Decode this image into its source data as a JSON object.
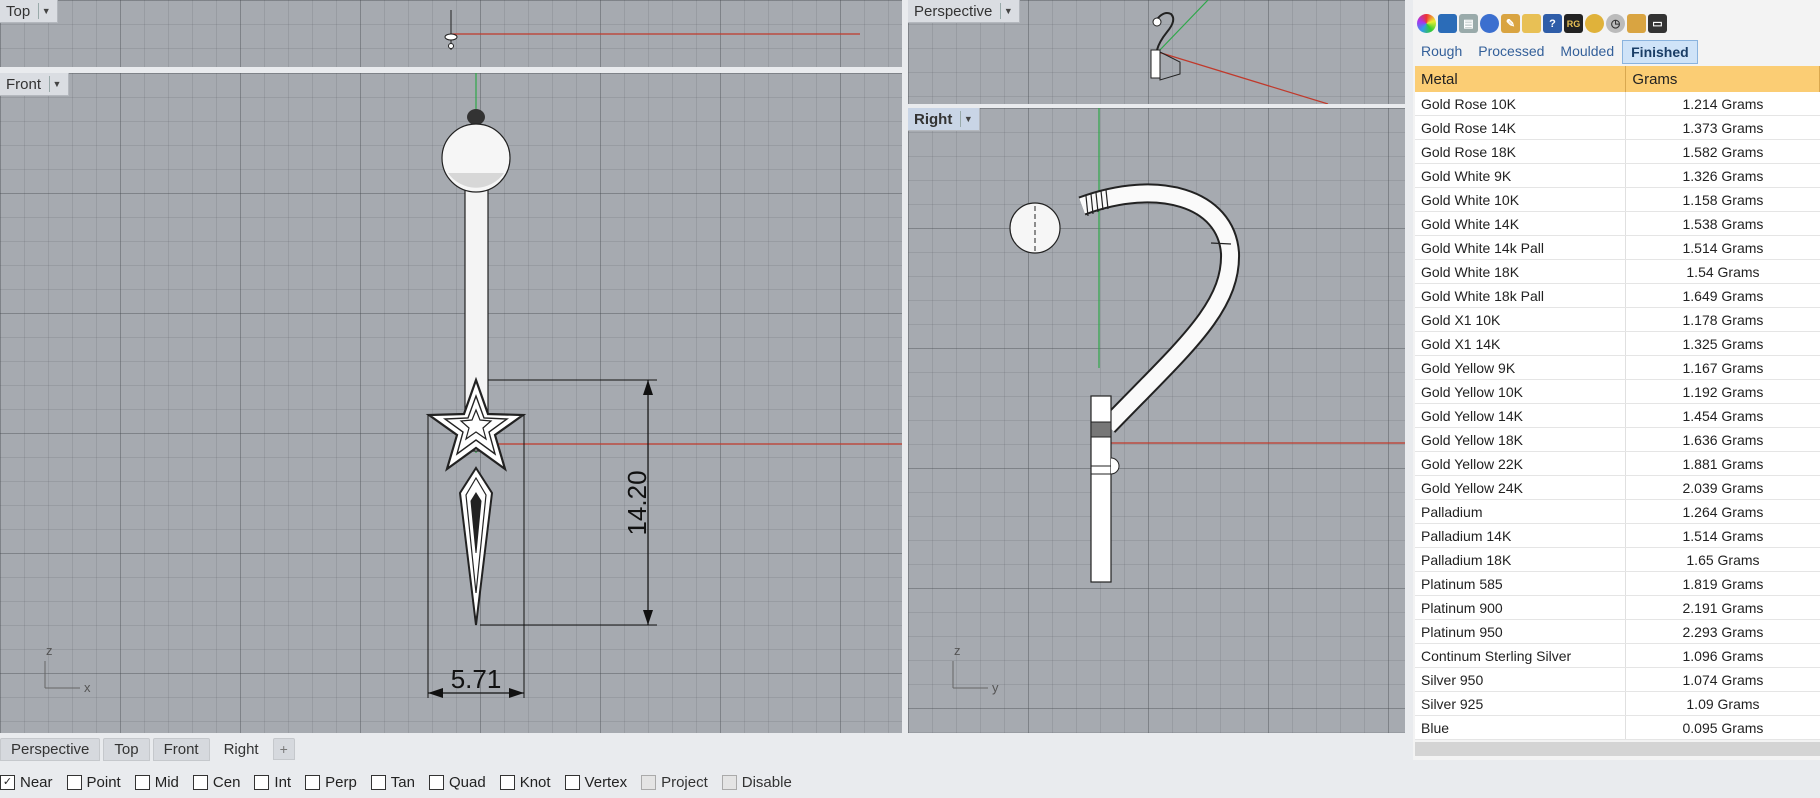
{
  "viewports": {
    "top": {
      "label": "Top"
    },
    "perspective": {
      "label": "Perspective"
    },
    "front": {
      "label": "Front",
      "dimension_height": "14.20",
      "dimension_width": "5.71",
      "axis_z": "z",
      "axis_x": "x"
    },
    "right": {
      "label": "Right",
      "axis_z": "z",
      "axis_y": "y"
    }
  },
  "viewport_tabs": [
    "Perspective",
    "Top",
    "Front",
    "Right"
  ],
  "add_tab_symbol": "+",
  "panel": {
    "tabs": [
      "Rough",
      "Processed",
      "Moulded",
      "Finished"
    ],
    "active_tab": "Finished",
    "columns": {
      "metal": "Metal",
      "grams": "Grams"
    },
    "rows": [
      {
        "metal": "Gold Rose 10K",
        "grams": "1.214 Grams"
      },
      {
        "metal": "Gold Rose 14K",
        "grams": "1.373 Grams"
      },
      {
        "metal": "Gold Rose 18K",
        "grams": "1.582 Grams"
      },
      {
        "metal": "Gold White 9K",
        "grams": "1.326 Grams"
      },
      {
        "metal": "Gold White 10K",
        "grams": "1.158 Grams"
      },
      {
        "metal": "Gold White 14K",
        "grams": "1.538 Grams"
      },
      {
        "metal": "Gold White 14k Pall",
        "grams": "1.514 Grams"
      },
      {
        "metal": "Gold White 18K",
        "grams": "1.54 Grams"
      },
      {
        "metal": "Gold White 18k Pall",
        "grams": "1.649 Grams"
      },
      {
        "metal": "Gold X1 10K",
        "grams": "1.178 Grams"
      },
      {
        "metal": "Gold X1 14K",
        "grams": "1.325 Grams"
      },
      {
        "metal": "Gold Yellow 9K",
        "grams": "1.167 Grams"
      },
      {
        "metal": "Gold Yellow 10K",
        "grams": "1.192 Grams"
      },
      {
        "metal": "Gold Yellow 14K",
        "grams": "1.454 Grams"
      },
      {
        "metal": "Gold Yellow 18K",
        "grams": "1.636 Grams"
      },
      {
        "metal": "Gold Yellow 22K",
        "grams": "1.881 Grams"
      },
      {
        "metal": "Gold Yellow 24K",
        "grams": "2.039 Grams"
      },
      {
        "metal": "Palladium",
        "grams": "1.264 Grams"
      },
      {
        "metal": "Palladium 14K",
        "grams": "1.514 Grams"
      },
      {
        "metal": "Palladium 18K",
        "grams": "1.65 Grams"
      },
      {
        "metal": "Platinum 585",
        "grams": "1.819 Grams"
      },
      {
        "metal": "Platinum 900",
        "grams": "2.191 Grams"
      },
      {
        "metal": "Platinum 950",
        "grams": "2.293 Grams"
      },
      {
        "metal": "Continum Sterling Silver",
        "grams": "1.096 Grams"
      },
      {
        "metal": "Silver 950",
        "grams": "1.074 Grams"
      },
      {
        "metal": "Silver 925",
        "grams": "1.09 Grams"
      },
      {
        "metal": "Blue",
        "grams": "0.095 Grams"
      }
    ],
    "toolbar_icons": [
      "color-wheel-icon",
      "shield-icon",
      "printer-icon",
      "globe-icon",
      "folder-icon",
      "folder-open-icon",
      "help-icon",
      "rg-icon",
      "coins-icon",
      "clock-icon",
      "gold-bars-icon",
      "monitor-icon"
    ]
  },
  "osnaps": [
    {
      "label": "Near",
      "checked": true
    },
    {
      "label": "Point",
      "checked": false
    },
    {
      "label": "Mid",
      "checked": false
    },
    {
      "label": "Cen",
      "checked": false
    },
    {
      "label": "Int",
      "checked": false
    },
    {
      "label": "Perp",
      "checked": false
    },
    {
      "label": "Tan",
      "checked": false
    },
    {
      "label": "Quad",
      "checked": false
    },
    {
      "label": "Knot",
      "checked": false
    },
    {
      "label": "Vertex",
      "checked": false
    },
    {
      "label": "Project",
      "checked": false,
      "disabled": true
    },
    {
      "label": "Disable",
      "checked": false,
      "disabled": true
    }
  ],
  "colors": {
    "table_header": "#fbcd74",
    "x_axis": "#c0392b",
    "z_axis": "#2ea84a",
    "active_tab": "#cfe3f8"
  }
}
